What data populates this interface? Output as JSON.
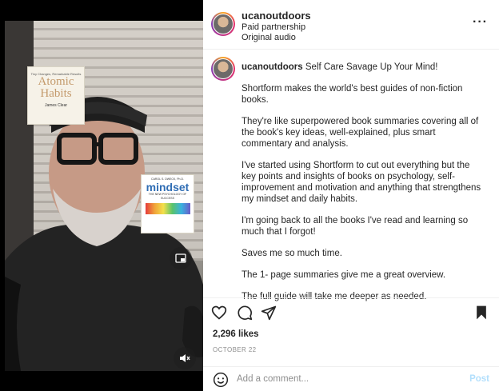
{
  "video": {
    "book1": {
      "tagline": "Tiny Changes, Remarkable Results",
      "title_line1": "Atomic",
      "title_line2": "Habits",
      "author": "James Clear"
    },
    "book2": {
      "author": "CAROL S. DWECK, Ph.D.",
      "title": "mindset",
      "subtitle": "THE NEW PSYCHOLOGY OF SUCCESS"
    }
  },
  "header": {
    "username": "ucanoutdoors",
    "line1": "Paid partnership",
    "line2": "Original audio",
    "more_icon": "more-horizontal-icon"
  },
  "caption": {
    "username": "ucanoutdoors",
    "headline": "Self Care Savage Up Your Mind!",
    "paragraphs": [
      "Shortform makes the world's best guides of non-fiction books.",
      "They're like superpowered book summaries covering all of the book's key ideas, well-explained, plus smart commentary and analysis.",
      "I've started using Shortform to cut out everything but the key points and insights of books on psychology, self-improvement and motivation and anything that strengthens my mindset and daily habits.",
      "I'm going back to all the books I've read and learning so much that I forgot!",
      "Saves me so much time.",
      "The 1- page summaries give me a great overview.",
      "The full guide will take me deeper as needed."
    ]
  },
  "actions": {
    "likes": "2,296 likes",
    "date": "OCTOBER 22"
  },
  "comment_box": {
    "placeholder": "Add a comment...",
    "post_label": "Post"
  },
  "colors": {
    "post_disabled": "#b2dffc",
    "muted_text": "#8e8e8e",
    "text": "#262626"
  }
}
